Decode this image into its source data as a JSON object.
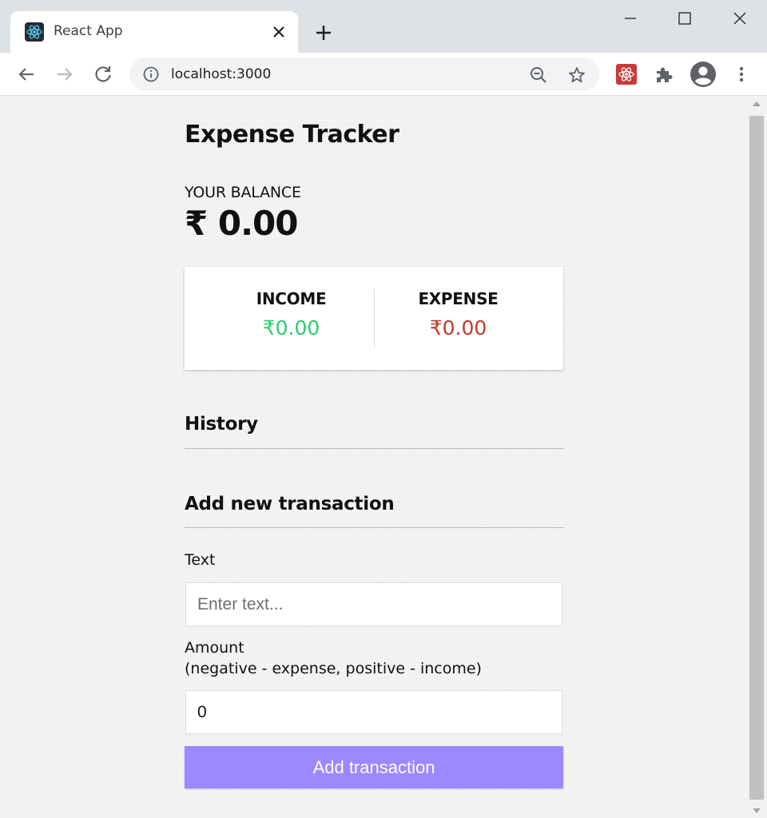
{
  "browser": {
    "tab_title": "React App",
    "url": "localhost:3000",
    "icons": {
      "favicon": "react-icon",
      "tab_close": "close-icon",
      "new_tab": "plus-icon",
      "back": "arrow-left-icon",
      "forward": "arrow-right-icon",
      "reload": "reload-icon",
      "site_info": "info-icon",
      "zoom": "zoom-out-icon",
      "bookmark": "star-icon",
      "extension": "react-devtools-icon",
      "extensions": "puzzle-icon",
      "profile": "account-icon",
      "menu": "kebab-menu-icon"
    }
  },
  "app": {
    "title": "Expense Tracker",
    "balance_label": "YOUR BALANCE",
    "balance_amount": "₹ 0.00",
    "income": {
      "label": "INCOME",
      "amount": "₹0.00",
      "color": "#2ecc71"
    },
    "expense": {
      "label": "EXPENSE",
      "amount": "₹0.00",
      "color": "#c0392b"
    },
    "history_title": "History",
    "add_title": "Add new transaction",
    "form": {
      "text_label": "Text",
      "text_placeholder": "Enter text...",
      "amount_label": "Amount",
      "amount_hint": "(negative - expense, positive - income)",
      "amount_value": "0",
      "submit_label": "Add transaction"
    },
    "colors": {
      "accent": "#9c88ff"
    }
  }
}
